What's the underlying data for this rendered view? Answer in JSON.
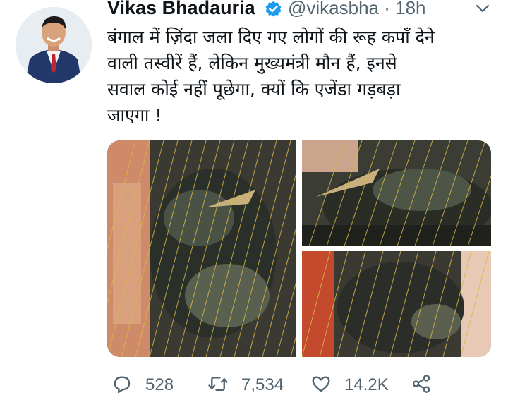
{
  "tweet": {
    "author_name": "Vikas Bhadauria",
    "handle_time": "@vikasbha · 18h",
    "text": "बंगाल में ज़िंदा जला दिए गए लोगों की रूह कपाँ देने\nवाली तस्वीरें हैं, लेकिन मुख्यमंत्री मौन हैं, इनसे\nसवाल कोई नहीं पूछेगा, क्यों कि एजेंडा गड़बड़ा\nजाएगा !",
    "verified_icon": "verified-badge-icon",
    "more_icon": "chevron-down-icon",
    "photo_count": 3
  },
  "actions": {
    "reply_count": "528",
    "retweet_count": "7,534",
    "like_count": "14.2K"
  },
  "colors": {
    "text_primary": "#0f1419",
    "text_secondary": "#536471",
    "verified_blue": "#1d9bf0"
  }
}
